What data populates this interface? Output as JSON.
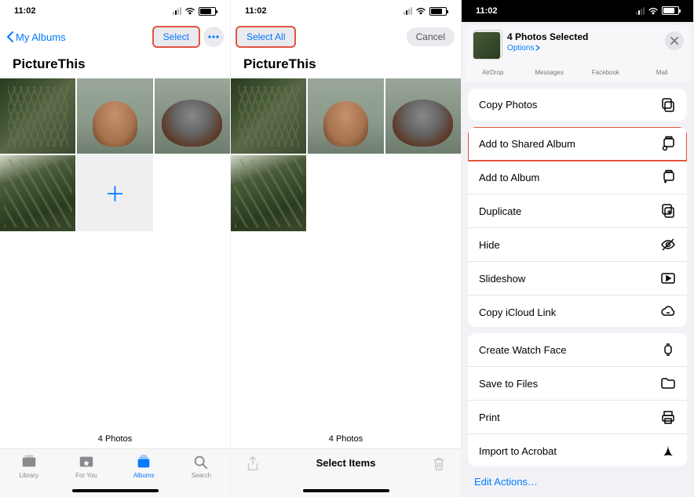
{
  "status": {
    "time": "11:02"
  },
  "phone1": {
    "back": "My Albums",
    "select": "Select",
    "title": "PictureThis",
    "count": "4 Photos",
    "tabs": {
      "library": "Library",
      "foryou": "For You",
      "albums": "Albums",
      "search": "Search"
    }
  },
  "phone2": {
    "selectall": "Select All",
    "cancel": "Cancel",
    "title": "PictureThis",
    "count": "4 Photos",
    "toolbar_mid": "Select Items"
  },
  "phone3": {
    "head_title": "4 Photos Selected",
    "head_options": "Options",
    "share": {
      "airdrop": "AirDrop",
      "messages": "Messages",
      "facebook": "Facebook",
      "mail": "Mail"
    },
    "rows": {
      "copy": "Copy Photos",
      "shared": "Add to Shared Album",
      "album": "Add to Album",
      "dup": "Duplicate",
      "hide": "Hide",
      "slides": "Slideshow",
      "icloud": "Copy iCloud Link",
      "watch": "Create Watch Face",
      "files": "Save to Files",
      "print": "Print",
      "acro": "Import to Acrobat"
    },
    "edit": "Edit Actions…"
  }
}
